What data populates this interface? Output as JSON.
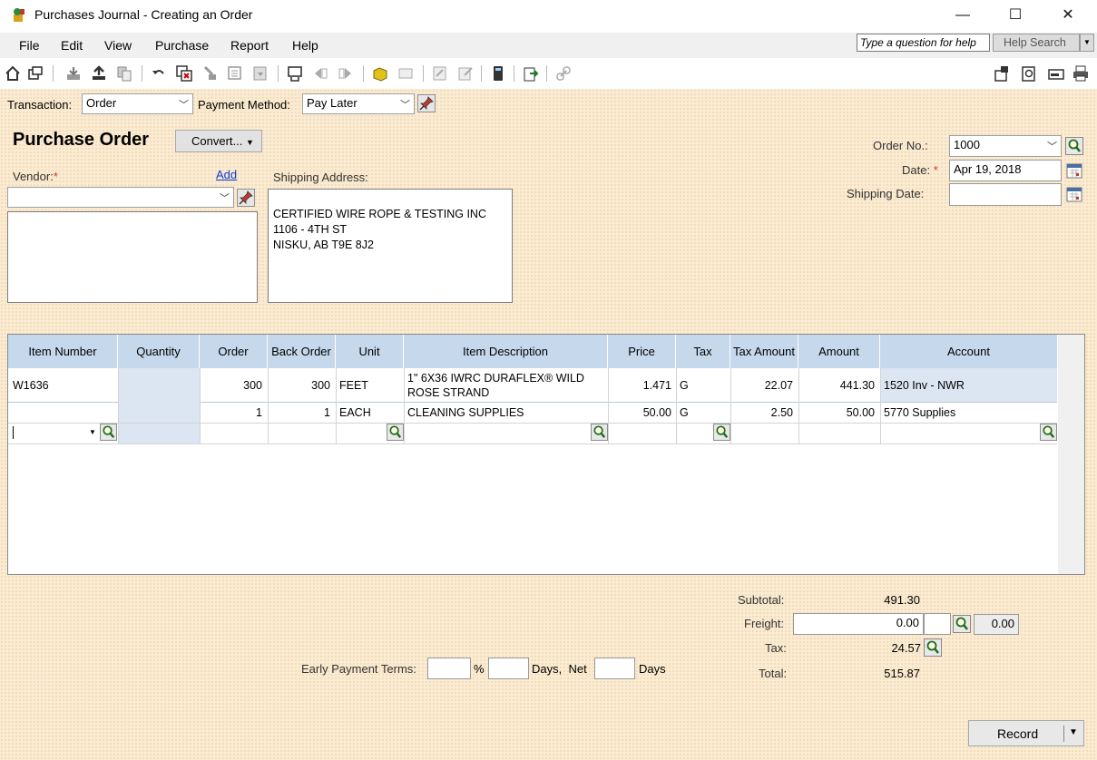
{
  "window": {
    "title": "Purchases Journal - Creating an Order",
    "minimize_glyph": "—",
    "maximize_glyph": "☐",
    "close_glyph": "✕"
  },
  "menu": {
    "items": [
      "File",
      "Edit",
      "View",
      "Purchase",
      "Report",
      "Help"
    ],
    "help_question_placeholder": "Type a question for help",
    "help_search_label": "Help Search"
  },
  "toolbar": {
    "icons": [
      "home-icon",
      "window-icon",
      "print-save-icon",
      "upload-icon",
      "copy-icon",
      "undo-icon",
      "remove-icon",
      "sort-icon",
      "fill-icon",
      "recall-icon",
      "adjust-icon",
      "first-icon",
      "previous-icon",
      "next-icon",
      "track-icon",
      "message-icon",
      "lookup-icon",
      "edit-icon",
      "calculator-icon",
      "export-icon",
      "link-icon"
    ],
    "right_icons": [
      "customize-icon",
      "preview-icon",
      "email-icon",
      "printer-icon"
    ]
  },
  "transaction": {
    "label": "Transaction:",
    "value": "Order",
    "payment_label": "Payment Method:",
    "payment_value": "Pay Later"
  },
  "form": {
    "heading": "Purchase Order",
    "convert_label": "Convert...",
    "vendor_label": "Vendor:",
    "required_mark": "*",
    "add_link": "Add",
    "vendor_value": "",
    "shipping_label": "Shipping Address:",
    "shipping_address": [
      "CERTIFIED WIRE ROPE & TESTING INC",
      "1106 - 4TH ST",
      "NISKU, AB  T9E 8J2"
    ],
    "order_no_label": "Order No.:",
    "order_no_value": "1000",
    "date_label": "Date:",
    "date_value": "Apr 19, 2018",
    "shipping_date_label": "Shipping Date:",
    "shipping_date_value": ""
  },
  "grid": {
    "headers": [
      "Item Number",
      "Quantity",
      "Order",
      "Back Order",
      "Unit",
      "Item Description",
      "Price",
      "Tax",
      "Tax Amount",
      "Amount",
      "Account"
    ],
    "rows": [
      {
        "item": "W1636",
        "quantity": "",
        "order": "300",
        "back_order": "300",
        "unit": "FEET",
        "description": "1\" 6X36 IWRC DURAFLEX® WILD ROSE STRAND",
        "price": "1.471",
        "tax": "G",
        "tax_amount": "22.07",
        "amount": "441.30",
        "account": "1520 Inv - NWR"
      },
      {
        "item": "",
        "quantity": "",
        "order": "1",
        "back_order": "1",
        "unit": "EACH",
        "description": "CLEANING SUPPLIES",
        "price": "50.00",
        "tax": "G",
        "tax_amount": "2.50",
        "amount": "50.00",
        "account": "5770 Supplies"
      }
    ]
  },
  "totals": {
    "subtotal_label": "Subtotal:",
    "subtotal_value": "491.30",
    "freight_label": "Freight:",
    "freight_value": "0.00",
    "freight_tax_code": "",
    "freight_tax_value": "0.00",
    "tax_label": "Tax:",
    "tax_value": "24.57",
    "total_label": "Total:",
    "total_value": "515.87"
  },
  "terms": {
    "label": "Early Payment Terms:",
    "percent_sign": "%",
    "days_net_label": "Days,  Net",
    "days_label": "Days",
    "discount_percent": "",
    "discount_days": "",
    "net_days": ""
  },
  "actions": {
    "record_label": "Record"
  }
}
